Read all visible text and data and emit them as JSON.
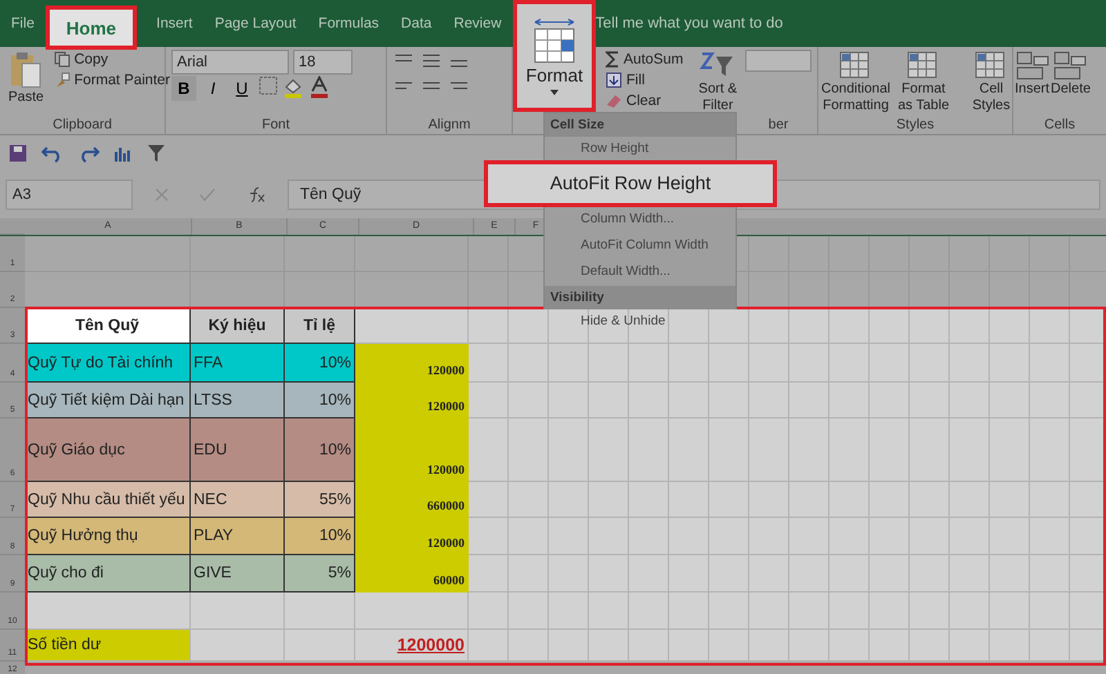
{
  "tabs": [
    {
      "label": "File",
      "selected": false
    },
    {
      "label": "Home",
      "selected": true
    },
    {
      "label": "Insert",
      "selected": false
    },
    {
      "label": "Page Layout",
      "selected": false
    },
    {
      "label": "Formulas",
      "selected": false
    },
    {
      "label": "Data",
      "selected": false
    },
    {
      "label": "Review",
      "selected": false
    }
  ],
  "tell_me": "Tell me what you want to do",
  "ribbon": {
    "clipboard": {
      "paste": "Paste",
      "copy": "Copy",
      "format_painter": "Format Painter",
      "label": "Clipboard"
    },
    "font": {
      "name": "Arial",
      "size": "18",
      "bold": "B",
      "italic": "I",
      "underline": "U",
      "label": "Font"
    },
    "alignment": {
      "label": "Alignm"
    },
    "format_button": "Format",
    "editing": {
      "autosum": "AutoSum",
      "fill": "Fill",
      "clear": "Clear",
      "sort": "Sort & Filter"
    },
    "number": {
      "label": "ber"
    },
    "styles": {
      "buttons": [
        "Conditional Formatting",
        "Format as Table",
        "Cell Styles"
      ],
      "label": "Styles"
    },
    "cells": {
      "buttons": [
        "Insert",
        "Delete"
      ],
      "label": "Cells"
    }
  },
  "format_menu": [
    {
      "kind": "header",
      "label": "Cell Size"
    },
    {
      "kind": "item",
      "label": "Row Height",
      "selected": false
    },
    {
      "kind": "item",
      "label": "AutoFit Row Height",
      "selected": true
    },
    {
      "kind": "item",
      "label": "Column Width...",
      "selected": false
    },
    {
      "kind": "item",
      "label": "AutoFit Column Width",
      "selected": false
    },
    {
      "kind": "item",
      "label": "Default Width...",
      "selected": false
    },
    {
      "kind": "header",
      "label": "Visibility"
    },
    {
      "kind": "item",
      "label": "Hide & Unhide",
      "selected": false
    }
  ],
  "formula_bar": {
    "name_box": "A3",
    "value": "Tên Quỹ"
  },
  "sheet": {
    "columns": [
      "A",
      "B",
      "C",
      "D",
      "E",
      "F"
    ],
    "blank_rows": [
      "1",
      "2"
    ],
    "header_row": "3",
    "headers": [
      "Tên Quỹ",
      "Ký hiệu",
      "Tỉ lệ"
    ],
    "funds": [
      {
        "row": "4",
        "name": "Quỹ Tự do Tài chính",
        "code": "FFA",
        "ratio": "10%",
        "amount": "120000",
        "color": "#00c8c8"
      },
      {
        "row": "5",
        "name": "Quỹ Tiết kiệm Dài hạn",
        "code": "LTSS",
        "ratio": "10%",
        "amount": "120000",
        "color": "#a6b6bc"
      },
      {
        "row": "6",
        "name": "Quỹ Giáo dục",
        "code": "EDU",
        "ratio": "10%",
        "amount": "120000",
        "color": "#b48c84"
      },
      {
        "row": "7",
        "name": "Quỹ Nhu cầu thiết yếu",
        "code": "NEC",
        "ratio": "55%",
        "amount": "660000",
        "color": "#d6bca8"
      },
      {
        "row": "8",
        "name": "Quỹ Hưởng thụ",
        "code": "PLAY",
        "ratio": "10%",
        "amount": "120000",
        "color": "#d4b878"
      },
      {
        "row": "9",
        "name": "Quỹ cho đi",
        "code": "GIVE",
        "ratio": "5%",
        "amount": "60000",
        "color": "#a8bca8"
      }
    ],
    "empty_row": "10",
    "total": {
      "row": "11",
      "label": "Số tiền dư",
      "amount": "1200000"
    },
    "tail_row": "12"
  }
}
